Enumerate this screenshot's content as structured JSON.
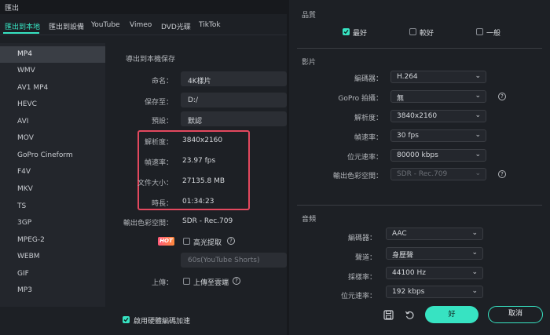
{
  "window": {
    "title": "匯出"
  },
  "tabs": [
    {
      "label": "匯出到本地",
      "active": true
    },
    {
      "label": "匯出到設備"
    },
    {
      "label": "YouTube"
    },
    {
      "label": "Vimeo"
    },
    {
      "label": "DVD光碟"
    },
    {
      "label": "TikTok"
    }
  ],
  "formats": [
    "MP4",
    "WMV",
    "AV1 MP4",
    "HEVC",
    "AVI",
    "MOV",
    "GoPro Cineform",
    "F4V",
    "MKV",
    "TS",
    "3GP",
    "MPEG-2",
    "WEBM",
    "GIF",
    "MP3"
  ],
  "selected_format": "MP4",
  "local": {
    "heading": "導出到本機保存",
    "name_label": "命名：",
    "name_value": "4K樣片",
    "save_label": "保存至：",
    "save_value": "D:/",
    "preset_label": "預設：",
    "preset_value": "默認",
    "resolution_label": "解析度：",
    "resolution_value": "3840x2160",
    "framerate_label": "幀速率：",
    "framerate_value": "23.97 fps",
    "filesize_label": "文件大小：",
    "filesize_value": "27135.8 MB",
    "duration_label": "時長：",
    "duration_value": "01:34:23",
    "colorspace_label": "輸出色彩空間：",
    "colorspace_value": "SDR - Rec.709",
    "hot_badge": "HOT",
    "highlight_label": "高光提取",
    "shorts_placeholder": "60s(YouTube Shorts)",
    "upload_label": "上傳：",
    "upload_cloud_label": "上傳至雲端",
    "hw_accel_label": "啟用硬體編碼加速"
  },
  "quality": {
    "title": "品質",
    "options": [
      {
        "label": "最好",
        "checked": true
      },
      {
        "label": "較好",
        "checked": false
      },
      {
        "label": "一般",
        "checked": false
      }
    ]
  },
  "video": {
    "title": "影片",
    "encoder_label": "編碼器：",
    "encoder_value": "H.264",
    "gopro_label": "GoPro 拍攝：",
    "gopro_value": "無",
    "resolution_label": "解析度：",
    "resolution_value": "3840x2160",
    "framerate_label": "幀速率：",
    "framerate_value": "30 fps",
    "bitrate_label": "位元速率：",
    "bitrate_value": "80000 kbps",
    "colorspace_label": "輸出色彩空間：",
    "colorspace_value": "SDR - Rec.709"
  },
  "audio": {
    "title": "音頻",
    "encoder_label": "編碼器：",
    "encoder_value": "AAC",
    "channel_label": "聲道：",
    "channel_value": "身歷聲",
    "samplerate_label": "採樣率：",
    "samplerate_value": "44100 Hz",
    "bitrate_label": "位元速率：",
    "bitrate_value": "192 kbps"
  },
  "footer": {
    "ok_label": "好",
    "cancel_label": "取消"
  },
  "colors": {
    "accent": "#37e3c2",
    "highlight_box": "#e3485e",
    "bg": "#17191d",
    "panel": "#1d2025"
  },
  "icons": {
    "question": "?",
    "chevron": "⌄",
    "save": "save-icon",
    "reset": "reset-icon"
  }
}
